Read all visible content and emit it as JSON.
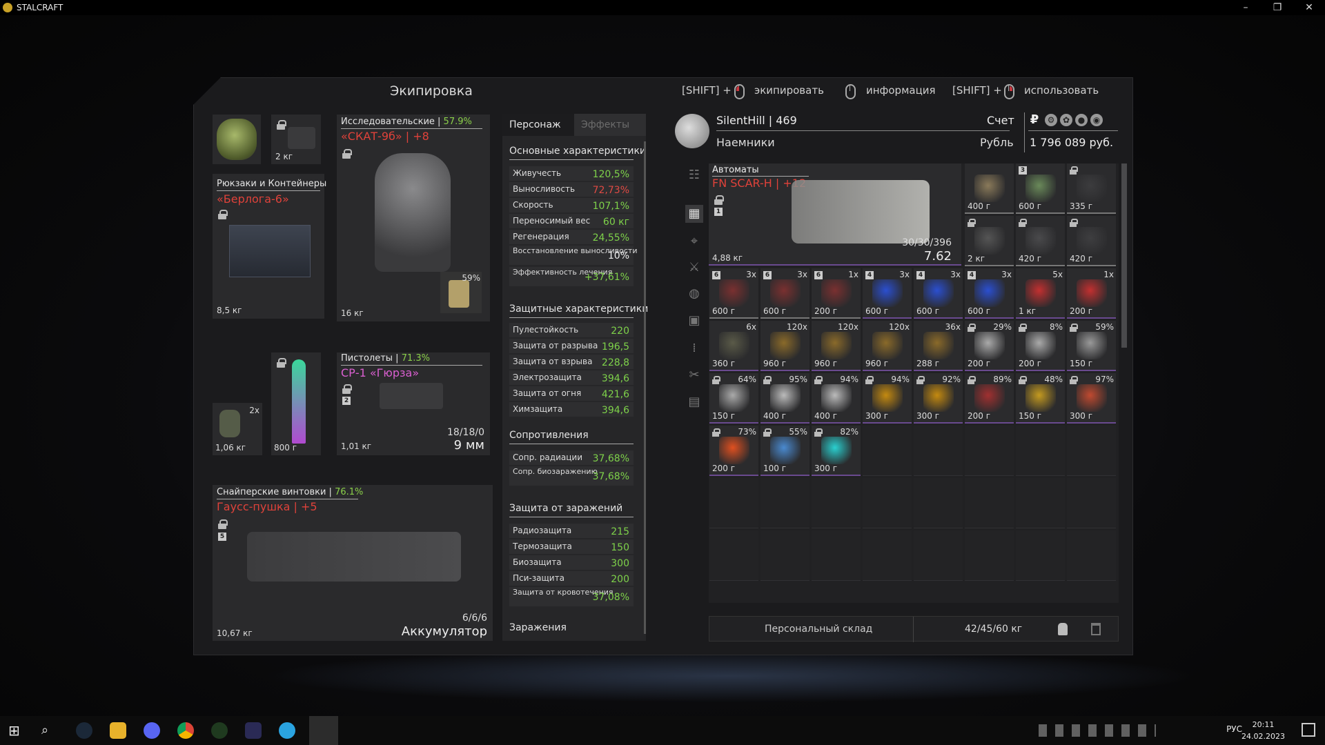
{
  "window": {
    "title": "STALCRAFT",
    "minimize": "–",
    "maximize": "❐",
    "close": "✕"
  },
  "panel": {
    "title": "Экипировка"
  },
  "hints": [
    {
      "prefix": "[SHIFT] +",
      "action": "экипировать"
    },
    {
      "prefix": "",
      "action": "информация"
    },
    {
      "prefix": "[SHIFT] +",
      "action": "использовать"
    }
  ],
  "equipment": {
    "head_weight": "2 кг",
    "backpack": {
      "category": "Рюкзаки и Контейнеры",
      "name": "«Берлога-6»",
      "weight": "8,5 кг"
    },
    "armor": {
      "category": "Исследовательские",
      "pct": "57.9%",
      "name": "«СКАТ-9б» | +8",
      "weight": "16 кг",
      "plate_pct": "59%"
    },
    "grenade": {
      "qty": "2x",
      "weight": "1,06 кг"
    },
    "knife": {
      "weight": "800 г"
    },
    "pistol": {
      "category": "Пистолеты",
      "pct": "71.3%",
      "name": "СР-1 «Гюрза»",
      "weight": "1,01 кг",
      "ammo": "18/18/0",
      "ammo_type": "9 мм",
      "tier": "2"
    },
    "sniper": {
      "category": "Снайперские винтовки",
      "pct": "76.1%",
      "name": "Гаусс-пушка | +5",
      "weight": "10,67 кг",
      "ammo": "6/6/6",
      "ammo_type": "Аккумулятор",
      "tier": "5"
    }
  },
  "stats": {
    "tabs": [
      "Персонаж",
      "Эффекты"
    ],
    "sections": {
      "main": "Основные характеристики",
      "protect": "Защитные характеристики",
      "resist": "Сопротивления",
      "infect": "Защита от заражений",
      "contam": "Заражения"
    },
    "main": [
      {
        "label": "Живучесть",
        "value": "120,5%"
      },
      {
        "label": "Выносливость",
        "value": "72,73%"
      },
      {
        "label": "Скорость",
        "value": "107,1%"
      },
      {
        "label": "Переносимый вес",
        "value": "60 кг"
      },
      {
        "label": "Регенерация",
        "value": "24,55%"
      },
      {
        "label": "Восстановление выносливости",
        "value": "10%"
      },
      {
        "label": "Эффективность лечения",
        "value": "+37,61%"
      }
    ],
    "protect": [
      {
        "label": "Пулестойкость",
        "value": "220"
      },
      {
        "label": "Защита от разрыва",
        "value": "196,5"
      },
      {
        "label": "Защита от взрыва",
        "value": "228,8"
      },
      {
        "label": "Электрозащита",
        "value": "394,6"
      },
      {
        "label": "Защита от огня",
        "value": "421,6"
      },
      {
        "label": "Химзащита",
        "value": "394,6"
      }
    ],
    "resist": [
      {
        "label": "Сопр. радиации",
        "value": "37,68%"
      },
      {
        "label": "Сопр. биозаражению",
        "value": "37,68%"
      }
    ],
    "infect": [
      {
        "label": "Радиозащита",
        "value": "215"
      },
      {
        "label": "Термозащита",
        "value": "150"
      },
      {
        "label": "Биозащита",
        "value": "300"
      },
      {
        "label": "Пси-защита",
        "value": "200"
      },
      {
        "label": "Защита от кровотечения",
        "value": "37,08%"
      }
    ]
  },
  "player": {
    "name": "SilentHill | 469",
    "faction": "Наемники",
    "account_label": "Счет",
    "currency_label": "Рубль",
    "money": "1 796 089 руб."
  },
  "inventory": {
    "weapon": {
      "category": "Автоматы",
      "name": "FN SCAR-H | +12",
      "weight": "4,88 кг",
      "ammo": "30/30/396",
      "caliber": "7.62",
      "tier": "1"
    },
    "slots": [
      {
        "w": "400 г"
      },
      {
        "w": "600 г",
        "t": "3"
      },
      {
        "w": "335 г"
      },
      {
        "w": "2 кг"
      },
      {
        "w": "420 г"
      },
      {
        "w": "420 г"
      },
      {
        "w": "600 г",
        "q": "3x",
        "t": "6"
      },
      {
        "w": "600 г",
        "q": "3x",
        "t": "6"
      },
      {
        "w": "200 г",
        "q": "1x",
        "t": "6"
      },
      {
        "w": "600 г",
        "q": "3x",
        "t": "4"
      },
      {
        "w": "600 г",
        "q": "3x",
        "t": "4"
      },
      {
        "w": "600 г",
        "q": "3x",
        "t": "4"
      },
      {
        "w": "1 кг",
        "q": "5x"
      },
      {
        "w": "200 г",
        "q": "1x"
      },
      {
        "w": "360 г",
        "q": "6x"
      },
      {
        "w": "960 г",
        "q": "120x"
      },
      {
        "w": "960 г",
        "q": "120x"
      },
      {
        "w": "960 г",
        "q": "120x"
      },
      {
        "w": "288 г",
        "q": "36x"
      },
      {
        "w": "200 г",
        "q": "29%"
      },
      {
        "w": "200 г",
        "q": "8%"
      },
      {
        "w": "150 г",
        "q": "59%"
      },
      {
        "w": "150 г",
        "q": "64%"
      },
      {
        "w": "400 г",
        "q": "95%"
      },
      {
        "w": "400 г",
        "q": "94%"
      },
      {
        "w": "300 г",
        "q": "94%"
      },
      {
        "w": "300 г",
        "q": "92%"
      },
      {
        "w": "200 г",
        "q": "89%"
      },
      {
        "w": "150 г",
        "q": "48%"
      },
      {
        "w": "300 г",
        "q": "97%"
      },
      {
        "w": "200 г",
        "q": "73%"
      },
      {
        "w": "100 г",
        "q": "55%"
      },
      {
        "w": "300 г",
        "q": "82%"
      }
    ],
    "storage_label": "Персональный склад",
    "weight": "42/45/60 кг"
  },
  "taskbar": {
    "lang": "РУС",
    "time": "20:11",
    "date": "24.02.2023"
  }
}
